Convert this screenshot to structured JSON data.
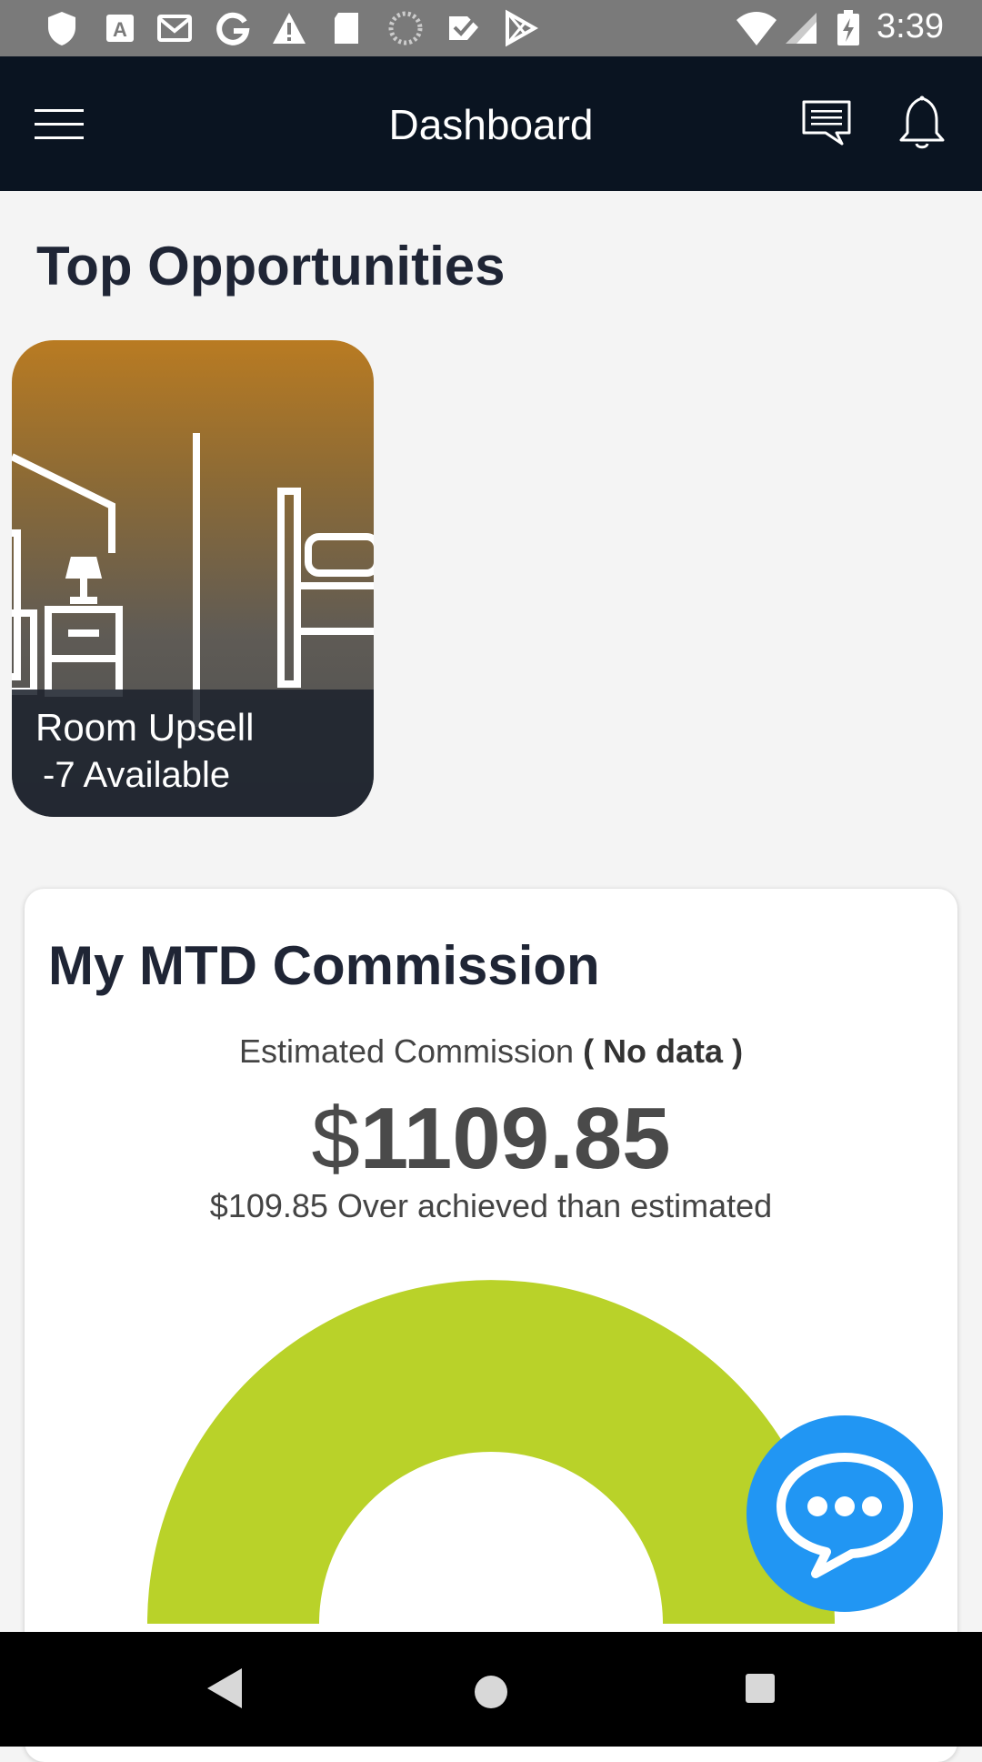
{
  "status_bar": {
    "time": "3:39",
    "icons": [
      "shield-icon",
      "accessibility-app-icon",
      "gmail-icon",
      "google-icon",
      "warning-icon",
      "sd-card-icon",
      "loading-icon",
      "checkmark-app-icon",
      "play-store-icon",
      "wifi-icon",
      "signal-icon",
      "battery-charging-icon"
    ]
  },
  "app_bar": {
    "title": "Dashboard",
    "icons": [
      "menu-icon",
      "chat-icon",
      "bell-icon"
    ]
  },
  "top_opportunities": {
    "title": "Top Opportunities",
    "cards": [
      {
        "title": "Room Upsell",
        "subtitle": " -7 Available"
      }
    ]
  },
  "commission": {
    "title": "My MTD Commission",
    "estimated_label": "Estimated Commission",
    "estimated_status": "( No data )",
    "currency_symbol": "$",
    "amount": "1109.85",
    "over_text": "$109.85 Over achieved than estimated",
    "gauge_color": "#b9d229"
  },
  "fab": {
    "icon": "chat-bubble-icon",
    "color": "#2196f3"
  },
  "nav_bar": {
    "icons": [
      "back-icon",
      "home-icon",
      "recents-icon"
    ]
  }
}
